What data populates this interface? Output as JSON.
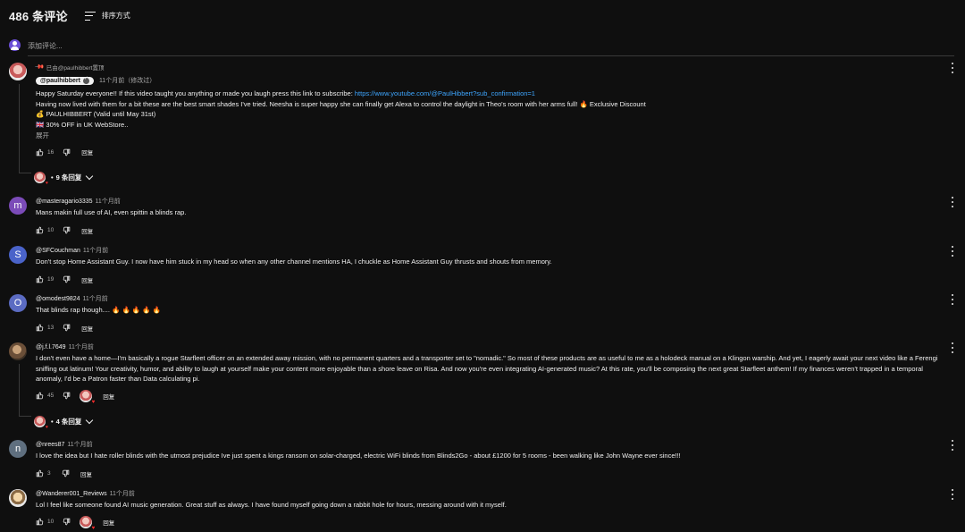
{
  "header": {
    "count": "486 条评论",
    "sort_label": "排序方式"
  },
  "add_comment": {
    "placeholder": "添加评论..."
  },
  "colors": {
    "background": "#0f0f0f",
    "link": "#3ea6ff"
  },
  "comments": [
    {
      "pinned_label": "已由@paulhibbert置顶",
      "author": "@paulhibbert",
      "time": "11个月前（修改过）",
      "line1_prefix": "Happy Saturday everyone!!  If this video taught you anything or made you laugh press this link to subscribe: ",
      "link": "https://www.youtube.com/@PaulHibbert?sub_confirmation=1",
      "line2": "Having now lived with them for a bit these are the best smart shades I've tried.  Neesha is super happy she can finally get Alexa to control the daylight in Theo's room with her arms full!  🔥  Exclusive Discount",
      "line3": "💰 PAULHIBBERT (Valid until May 31st)",
      "line4": "🇬🇧 30% OFF in UK WebStore..",
      "expand": "展开",
      "likes": "16",
      "reply": "回复",
      "replies": "9 条回复"
    },
    {
      "author": "@masteragario3335",
      "time": "11个月前",
      "avatar_letter": "m",
      "text": "Mans makin full use of AI, even spittin a blinds rap.",
      "likes": "10",
      "reply": "回复"
    },
    {
      "author": "@SFCouchman",
      "time": "11个月前",
      "avatar_letter": "S",
      "text": "Don't stop Home Assistant Guy. I now have him stuck in my head so when any other channel mentions HA, I chuckle as Home Assistant Guy thrusts and shouts from memory.",
      "likes": "19",
      "reply": "回复"
    },
    {
      "author": "@omodest9824",
      "time": "11个月前",
      "avatar_letter": "O",
      "text": "That blinds rap though.... 🔥 🔥 🔥 🔥 🔥",
      "likes": "13",
      "reply": "回复"
    },
    {
      "author": "@j.f.l.7649",
      "time": "11个月前",
      "text": "I don't even have a home—I'm basically a rogue Starfleet officer on an extended away mission, with no permanent quarters and a transporter set to \"nomadic.\" So most of these products are as useful to me as a holodeck manual on a Klingon warship. And yet, I eagerly await your next video like a Ferengi sniffing out latinum! Your creativity, humor, and ability to laugh at yourself make your content more enjoyable than a shore leave on Risa. And now you're even integrating AI-generated music? At this rate, you'll be composing the next great Starfleet anthem! If my finances weren't trapped in a temporal anomaly, I'd be a Patron faster than Data calculating pi.",
      "likes": "45",
      "reply": "回复",
      "replies": "4 条回复"
    },
    {
      "author": "@nrees87",
      "time": "11个月前",
      "avatar_letter": "n",
      "text": "I love the idea but I hate roller blinds with the utmost prejudice        Ive just spent a kings ransom on solar-charged, electric WiFi blinds from Blinds2Go - about £1200 for 5 rooms - been walking like John Wayne ever since!!!",
      "likes": "3",
      "reply": "回复"
    },
    {
      "author": "@Wanderer001_Reviews",
      "time": "11个月前",
      "text": "Lol I feel like someone found AI music generation.  Great stuff as always.  I have found myself going down a rabbit hole for hours, messing around with it myself.",
      "likes": "10",
      "reply": "回复"
    }
  ]
}
